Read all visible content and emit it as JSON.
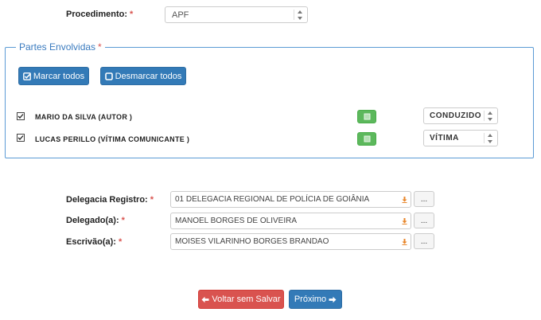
{
  "procedimento": {
    "label": "Procedimento:",
    "required": "*",
    "value": "APF"
  },
  "partes": {
    "legend": "Partes Envolvidas",
    "required": "*",
    "marcar_label": "Marcar todos",
    "desmarcar_label": "Desmarcar todos",
    "items": [
      {
        "name": "MARIO DA SILVA (AUTOR )",
        "role": "CONDUZIDO",
        "checked": true
      },
      {
        "name": "LUCAS PERILLO (VÍTIMA COMUNICANTE )",
        "role": "VÍTIMA",
        "checked": true
      }
    ]
  },
  "registro": {
    "delegacia": {
      "label": "Delegacia Registro:",
      "required": "*",
      "value": "01 DELEGACIA REGIONAL DE POLÍCIA DE GOIÂNIA",
      "btn": "..."
    },
    "delegado": {
      "label": "Delegado(a):",
      "required": "*",
      "value": "MANOEL BORGES DE OLIVEIRA",
      "btn": "..."
    },
    "escrivao": {
      "label": "Escrivão(a):",
      "required": "*",
      "value": "MOISES VILARINHO BORGES BRANDAO",
      "btn": "..."
    }
  },
  "footer": {
    "voltar_label": "Voltar sem Salvar",
    "proximo_label": "Próximo"
  },
  "colors": {
    "primary": "#337ab7",
    "success": "#5cb85c",
    "danger": "#d9534f",
    "fieldset_border": "#5b9bd5",
    "download_icon": "#e8862a"
  },
  "icons": [
    "check-square-icon",
    "square-icon",
    "arrow-left-icon",
    "arrow-right-icon",
    "download-icon",
    "checkbox-icon",
    "edit-square-icon"
  ]
}
